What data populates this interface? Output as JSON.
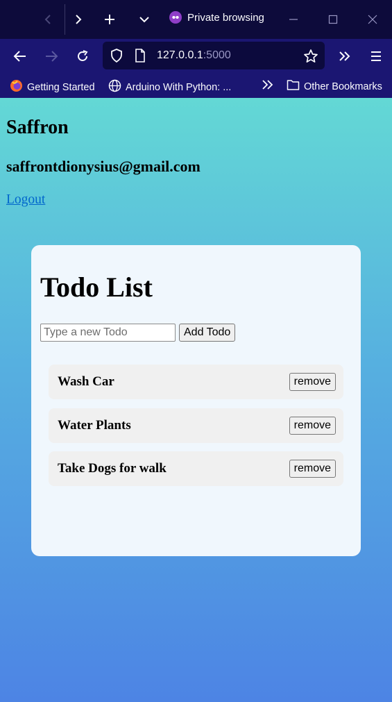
{
  "browser": {
    "private_label": "Private browsing",
    "url_host": "127.0.0.1",
    "url_port": ":5000",
    "bookmarks": [
      {
        "label": "Getting Started",
        "icon": "firefox-icon"
      },
      {
        "label": "Arduino With Python: ...",
        "icon": "globe-icon"
      }
    ],
    "other_bookmarks": "Other Bookmarks"
  },
  "user": {
    "name": "Saffron",
    "email": "saffrontdionysius@gmail.com",
    "logout_label": "Logout"
  },
  "todo": {
    "title": "Todo List",
    "input_placeholder": "Type a new Todo",
    "input_value": "",
    "add_label": "Add Todo",
    "remove_label": "remove",
    "items": [
      {
        "text": "Wash Car"
      },
      {
        "text": "Water Plants"
      },
      {
        "text": "Take Dogs for walk"
      }
    ]
  },
  "colors": {
    "chrome_dark": "#0d0b3b",
    "chrome_bar": "#1b1672",
    "gradient_top": "#63d8d5",
    "gradient_bottom": "#4d84e4",
    "card_bg": "#f0f7fd",
    "link": "#0066cc"
  }
}
